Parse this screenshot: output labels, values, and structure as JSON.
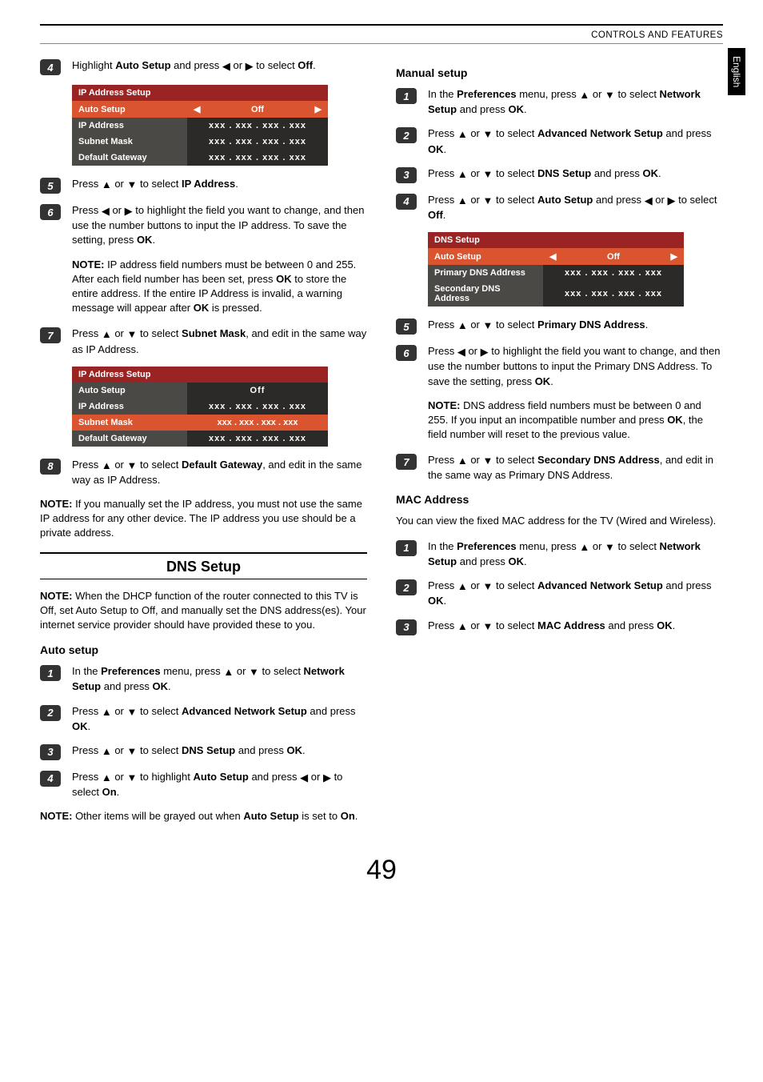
{
  "header": {
    "section": "CONTROLS AND FEATURES",
    "lang_tab": "English"
  },
  "icons": {
    "up": "▲",
    "down": "▼",
    "left": "◀",
    "right": "▶"
  },
  "left": {
    "step4": {
      "pre": "Highlight ",
      "b1": "Auto Setup",
      "mid": " and press ",
      "post": " to select ",
      "b2": "Off",
      "end": "."
    },
    "table1": {
      "title": "IP Address Setup",
      "auto": {
        "label": "Auto Setup",
        "val": "Off"
      },
      "rows": [
        {
          "label": "IP Address",
          "val": "xxx   .   xxx   .   xxx   .   xxx"
        },
        {
          "label": "Subnet Mask",
          "val": "xxx   .   xxx   .   xxx   .   xxx"
        },
        {
          "label": "Default Gateway",
          "val": "xxx   .   xxx   .   xxx   .   xxx"
        }
      ]
    },
    "step5": {
      "pre": "Press ",
      "mid": " or ",
      "post": " to select ",
      "b": "IP Address",
      "end": "."
    },
    "step6": {
      "pre": "Press ",
      "mid": " or ",
      "post": " to highlight the field you want to change, and then use the number buttons to input the IP address. To save the setting, press ",
      "b": "OK",
      "end": "."
    },
    "note6": {
      "pre": "NOTE: ",
      "body1": "IP address field numbers must be between 0 and 255. After each field number has been set, press ",
      "b1": "OK",
      "body2": " to store the entire address. If the entire IP Address is invalid, a warning message will appear after ",
      "b2": "OK",
      "body3": " is pressed."
    },
    "step7": {
      "pre": "Press ",
      "mid": " or ",
      "post": " to select ",
      "b": "Subnet Mask",
      "end": ", and edit in the same way as IP Address."
    },
    "table2": {
      "title": "IP Address Setup",
      "auto": {
        "label": "Auto Setup",
        "val": "Off"
      },
      "rows": [
        {
          "label": "IP Address",
          "val": "xxx   .   xxx   .   xxx   .   xxx"
        },
        {
          "label": "Subnet Mask",
          "val": "xxx   .   xxx   .   xxx   .   xxx"
        },
        {
          "label": "Default Gateway",
          "val": "xxx   .   xxx   .   xxx   .   xxx"
        }
      ]
    },
    "step8": {
      "pre": "Press ",
      "mid": " or ",
      "post": " to select ",
      "b": "Default Gateway",
      "end": ", and edit in the same way as IP Address."
    },
    "note_ip": {
      "pre": "NOTE: ",
      "body": "If you manually set the IP address, you must not use the same IP address for any other device. The IP address you use should be a private address."
    },
    "dns_title": "DNS Setup",
    "dns_note": {
      "pre": "NOTE: ",
      "body": "When the DHCP function of the router connected to this TV is Off, set Auto Setup to Off, and manually set the DNS address(es). Your internet service provider should have provided these to you."
    },
    "auto_h": "Auto setup",
    "a1": {
      "pre": "In the ",
      "b1": "Preferences",
      "mid": " menu, press ",
      "or": " or ",
      "post": " to select ",
      "b2": "Network Setup",
      "mid2": " and press ",
      "b3": "OK",
      "end": "."
    },
    "a2": {
      "pre": "Press ",
      "or": " or ",
      "post": " to select ",
      "b1": "Advanced Network Setup",
      "mid": " and press ",
      "b2": "OK",
      "end": "."
    },
    "a3": {
      "pre": "Press ",
      "or": " or ",
      "post": " to select ",
      "b1": "DNS Setup",
      "mid": " and press ",
      "b2": "OK",
      "end": "."
    },
    "a4": {
      "pre": "Press ",
      "or": " or ",
      "post": " to highlight ",
      "b1": "Auto Setup",
      "mid": " and press ",
      "or2": " or ",
      "post2": " to select ",
      "b2": "On",
      "end": "."
    },
    "a_note": {
      "pre": "NOTE: ",
      "body1": "Other items will be grayed out when ",
      "b": "Auto Setup",
      "body2": " is set to ",
      "b2": "On",
      "end": "."
    }
  },
  "right": {
    "manual_h": "Manual setup",
    "m1": {
      "pre": "In the ",
      "b1": "Preferences",
      "mid": " menu, press ",
      "or": " or ",
      "post": " to select ",
      "b2": "Network Setup",
      "mid2": " and press ",
      "b3": "OK",
      "end": "."
    },
    "m2": {
      "pre": "Press ",
      "or": " or ",
      "post": " to select ",
      "b1": "Advanced Network Setup",
      "mid": " and press ",
      "b2": "OK",
      "end": "."
    },
    "m3": {
      "pre": "Press ",
      "or": " or ",
      "post": " to select ",
      "b1": "DNS Setup",
      "mid": " and press ",
      "b2": "OK",
      "end": "."
    },
    "m4": {
      "pre": "Press ",
      "or": " or ",
      "post": " to select ",
      "b1": "Auto Setup",
      "mid": " and press ",
      "or2": " or ",
      "post2": " to select ",
      "b2": "Off",
      "end": "."
    },
    "table": {
      "title": "DNS Setup",
      "auto": {
        "label": "Auto Setup",
        "val": "Off"
      },
      "rows": [
        {
          "label": "Primary DNS Address",
          "val": "xxx   .   xxx   .   xxx   .   xxx"
        },
        {
          "label": "Secondary DNS Address",
          "val": "xxx   .   xxx   .   xxx   .   xxx"
        }
      ]
    },
    "m5": {
      "pre": "Press ",
      "or": " or ",
      "post": " to select ",
      "b": "Primary DNS Address",
      "end": "."
    },
    "m6": {
      "pre": "Press ",
      "or": " or ",
      "post": " to highlight the field you want to change, and then use the number buttons to input the Primary DNS Address. To save the setting, press ",
      "b": "OK",
      "end": "."
    },
    "m6_note": {
      "pre": "NOTE: ",
      "body1": "DNS address field numbers must be between 0 and 255. If you input an incompatible number and press ",
      "b": "OK",
      "body2": ", the field number will reset to the previous value."
    },
    "m7": {
      "pre": "Press ",
      "or": " or ",
      "post": " to select ",
      "b": "Secondary DNS Address",
      "end": ", and edit in the same way as Primary DNS Address."
    },
    "mac_h": "MAC Address",
    "mac_intro": " You can view the fixed MAC address for the TV (Wired and Wireless).",
    "mac1": {
      "pre": "In the ",
      "b1": "Preferences",
      "mid": " menu, press ",
      "or": " or ",
      "post": " to select ",
      "b2": "Network Setup",
      "mid2": " and press ",
      "b3": "OK",
      "end": "."
    },
    "mac2": {
      "pre": "Press ",
      "or": " or ",
      "post": " to select ",
      "b1": "Advanced Network Setup",
      "mid": " and press ",
      "b2": "OK",
      "end": "."
    },
    "mac3": {
      "pre": "Press ",
      "or": " or ",
      "post": " to select ",
      "b1": "MAC Address",
      "mid": " and press ",
      "b2": "OK",
      "end": "."
    }
  },
  "page_number": "49"
}
